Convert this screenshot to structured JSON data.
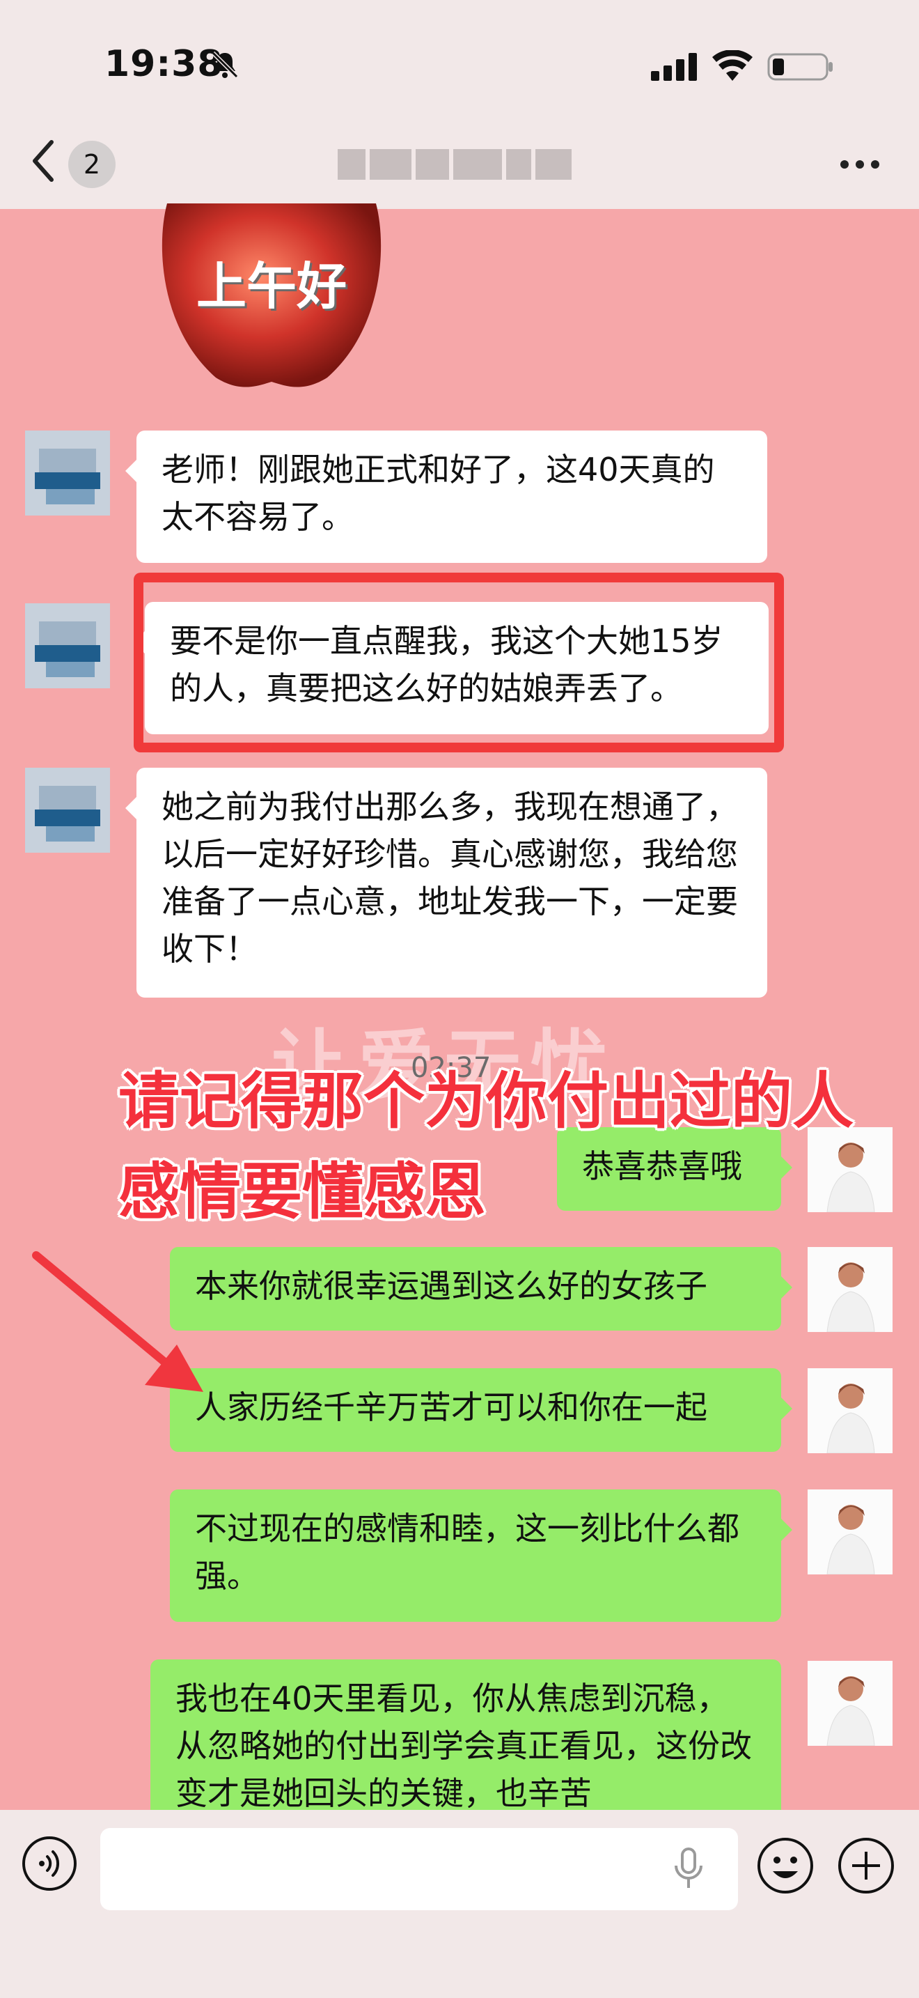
{
  "status": {
    "time": "19:38"
  },
  "nav": {
    "unread_count": "2"
  },
  "sticker": {
    "text": "上午好"
  },
  "messages": [
    {
      "side": "left",
      "text": "老师！刚跟她正式和好了，这40天真的太不容易了。"
    },
    {
      "side": "left",
      "text": "要不是你一直点醒我，我这个大她15岁的人，真要把这么好的姑娘弄丢了。"
    },
    {
      "side": "left",
      "text": "她之前为我付出那么多，我现在想通了，以后一定好好珍惜。真心感谢您，我给您准备了一点心意，地址发我一下，一定要收下！"
    },
    {
      "side": "right",
      "text": "恭喜恭喜哦"
    },
    {
      "side": "right",
      "text": "本来你就很幸运遇到这么好的女孩子"
    },
    {
      "side": "right",
      "text": "人家历经千辛万苦才可以和你在一起"
    },
    {
      "side": "right",
      "text": "不过现在的感情和睦，这一刻比什么都强。"
    },
    {
      "side": "right",
      "text": "我也在40天里看见，你从焦虑到沉稳，从忽略她的付出到学会真正看见，这份改变才是她回头的关键，也辛苦"
    }
  ],
  "timestamp": "02:37",
  "watermark": "让爱无忧",
  "annotation": {
    "line1": "请记得那个为你付出过的人",
    "line2": "感情要懂感恩"
  },
  "colors": {
    "chat_bg": "#f6a7a9",
    "green_bubble": "#95ec69",
    "highlight": "#f03a3a",
    "annotation": "#f4303c"
  },
  "icons": [
    "bell-slash-icon",
    "signal-icon",
    "wifi-icon",
    "battery-icon",
    "back-chevron-icon",
    "more-icon",
    "voice-icon",
    "mic-icon",
    "emoji-icon",
    "plus-icon"
  ]
}
